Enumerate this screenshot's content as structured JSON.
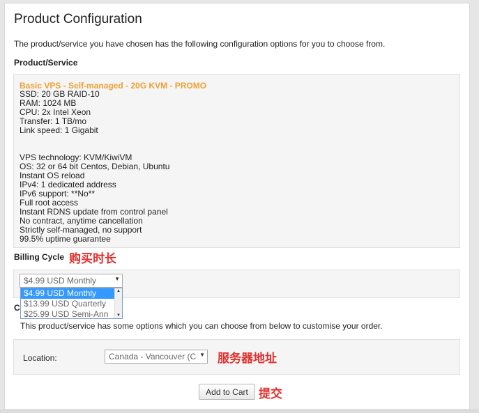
{
  "page": {
    "title": "Product Configuration",
    "intro": "The product/service you have chosen has the following configuration options for you to choose from."
  },
  "product_section": {
    "label": "Product/Service",
    "name": "Basic VPS - Self-managed - 20G KVM - PROMO",
    "specs": [
      "SSD: 20 GB RAID-10",
      "RAM: 1024 MB",
      "CPU: 2x Intel Xeon",
      "Transfer: 1 TB/mo",
      "Link speed: 1 Gigabit"
    ],
    "features": [
      "VPS technology: KVM/KiwiVM",
      "OS: 32 or 64 bit Centos, Debian, Ubuntu",
      "Instant OS reload",
      "IPv4: 1 dedicated address",
      "IPv6 support: **No**",
      "Full root access",
      "Instant RDNS update from control panel",
      "No contract, anytime cancellation",
      "Strictly self-managed, no support",
      "99.5% uptime guarantee"
    ]
  },
  "billing": {
    "label": "Billing Cycle",
    "annotation": "购买时长",
    "selected": "$4.99 USD Monthly",
    "options": [
      "$4.99 USD Monthly",
      "$13.99 USD Quarterly",
      "$25.99 USD Semi-Ann"
    ]
  },
  "config": {
    "hidden_label": "C",
    "description": "This product/service has some options which you can choose from below to customise your order.",
    "location_label": "Location:",
    "location_value": "Canada - Vancouver (C",
    "location_annotation": "服务器地址"
  },
  "actions": {
    "add_to_cart": "Add to Cart",
    "submit_annotation": "提交"
  }
}
